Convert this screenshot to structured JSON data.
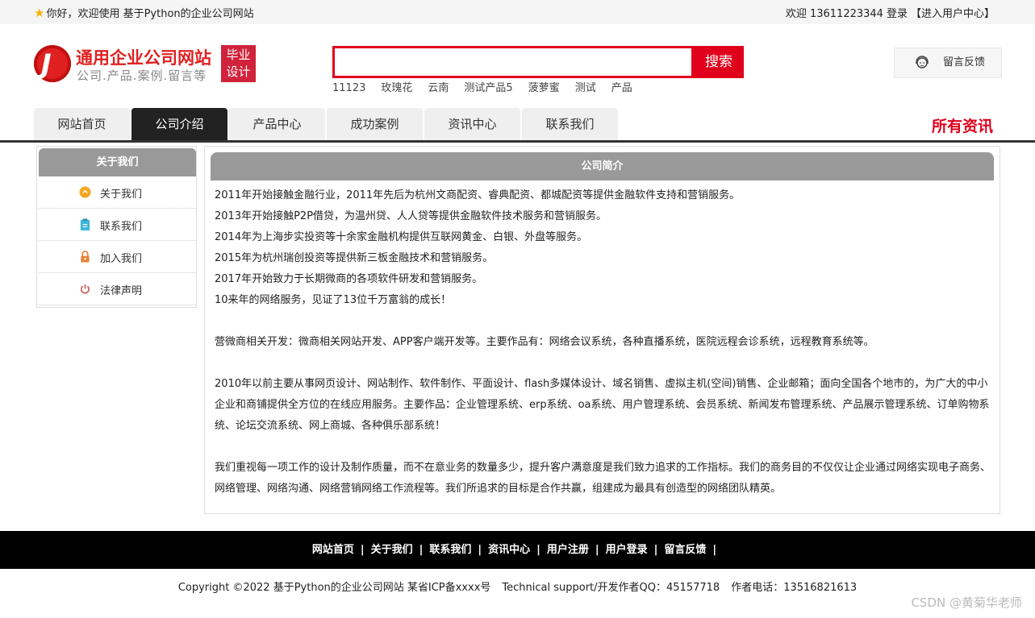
{
  "topbar": {
    "welcome": "你好，欢迎使用 基于Python的企业公司网站",
    "user_greeting": "欢迎 13611223344",
    "login": "登录",
    "user_center": "【进入用户中心】"
  },
  "header": {
    "logo_title": "通用企业公司网站",
    "logo_subtitle": "公司.产品.案例.留言等",
    "badge_line1": "毕业",
    "badge_line2": "设计",
    "search_placeholder": "",
    "search_button": "搜索",
    "hotwords": [
      "11123",
      "玫瑰花",
      "云南",
      "测试产品5",
      "菠萝蜜",
      "测试",
      "产品"
    ],
    "feedback": "留言反馈"
  },
  "nav": {
    "items": [
      "网站首页",
      "公司介绍",
      "产品中心",
      "成功案例",
      "资讯中心",
      "联系我们"
    ],
    "active_index": 1,
    "all_news": "所有资讯"
  },
  "sidebar": {
    "title": "关于我们",
    "items": [
      {
        "label": "关于我们",
        "icon": "orange-circle-icon",
        "color": "#f5a623"
      },
      {
        "label": "联系我们",
        "icon": "clipboard-icon",
        "color": "#3fb5d8"
      },
      {
        "label": "加入我们",
        "icon": "lock-icon",
        "color": "#e8843a"
      },
      {
        "label": "法律声明",
        "icon": "power-icon",
        "color": "#c9625a"
      }
    ]
  },
  "content": {
    "title": "公司简介",
    "paragraphs": [
      "2011年开始接触金融行业，2011年先后为杭州文商配资、睿典配资、都城配资等提供金融软件支持和营销服务。",
      "2013年开始接触P2P借贷，为温州贷、人人贷等提供金融软件技术服务和营销服务。",
      "2014年为上海步实投资等十余家金融机构提供互联网黄金、白银、外盘等服务。",
      "2015年为杭州瑞创投资等提供新三板金融技术和营销服务。",
      "2017年开始致力于长期微商的各项软件研发和营销服务。",
      "10来年的网络服务，见证了13位千万富翁的成长！",
      "",
      "营微商相关开发：微商相关网站开发、APP客户端开发等。主要作品有：网络会议系统，各种直播系统，医院远程会诊系统，远程教育系统等。",
      "",
      "2010年以前主要从事网页设计、网站制作、软件制作、平面设计、flash多媒体设计、域名销售、虚拟主机(空间)销售、企业邮箱；面向全国各个地市的，为广大的中小企业和商铺提供全方位的在线应用服务。主要作品：企业管理系统、erp系统、oa系统、用户管理系统、会员系统、新闻发布管理系统、产品展示管理系统、订单购物系统、论坛交流系统、网上商城、各种俱乐部系统！",
      "",
      "我们重视每一项工作的设计及制作质量，而不在意业务的数量多少，提升客户满意度是我们致力追求的工作指标。我们的商务目的不仅仅让企业通过网络实现电子商务、网络管理、网络沟通、网络营销网络工作流程等。我们所追求的目标是合作共赢，组建成为最具有创造型的网络团队精英。"
    ]
  },
  "footer": {
    "links": [
      "网站首页",
      "关于我们",
      "联系我们",
      "资讯中心",
      "用户注册",
      "用户登录",
      "留言反馈"
    ],
    "copyright": "Copyright ©2022 基于Python的企业公司网站 某省ICP备xxxx号",
    "support": "Technical support/开发作者QQ：45157718",
    "phone": "作者电话：13516821613"
  },
  "watermark": "CSDN @黄菊华老师",
  "colors": {
    "accent": "#e0001b",
    "nav_active": "#222222",
    "panel_head": "#999999"
  }
}
